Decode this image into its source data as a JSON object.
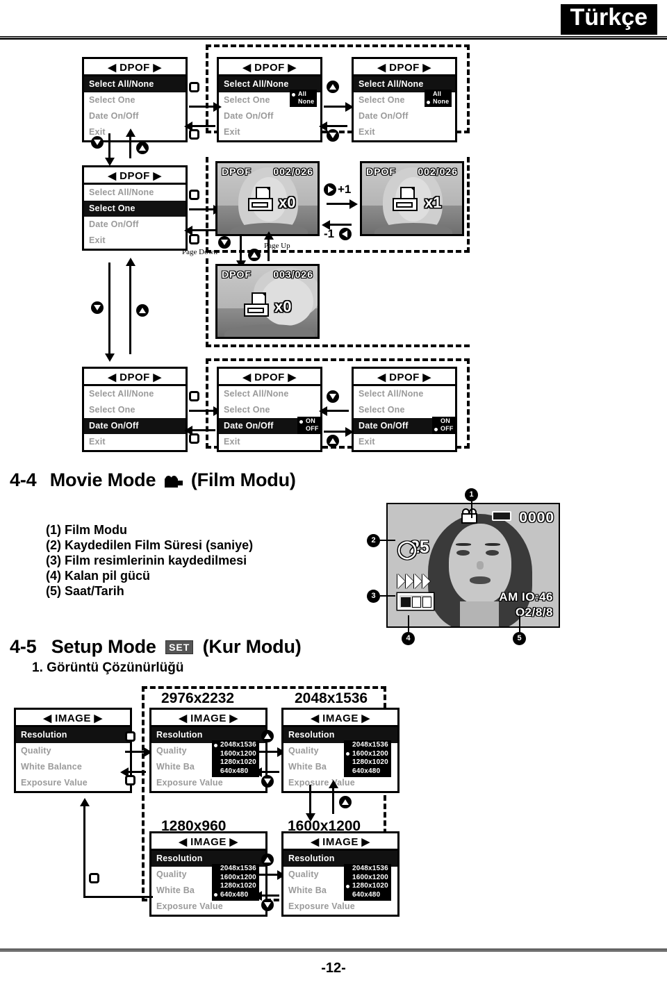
{
  "header": {
    "language": "Türkçe"
  },
  "footer": {
    "page_number": "-12-"
  },
  "dpof": {
    "menu_title": "◀ DPOF ▶",
    "items": {
      "select_all_none": "Select All/None",
      "select_one": "Select One",
      "date_on_off": "Date On/Off",
      "exit": "Exit"
    },
    "all_none_options": {
      "all": "All",
      "none": "None"
    },
    "date_options": {
      "on": "ON",
      "off": "OFF"
    },
    "previews": [
      {
        "label": "DPOF",
        "counter": "002/026",
        "multiplier": "x0"
      },
      {
        "label": "DPOF",
        "counter": "002/026",
        "multiplier": "x1"
      },
      {
        "label": "DPOF",
        "counter": "003/026",
        "multiplier": "x0"
      }
    ],
    "transitions": {
      "plus_one": "+1",
      "minus_one": "-1"
    },
    "paging": {
      "page_up": "Page Up",
      "page_down": "Page Down"
    }
  },
  "movie_section": {
    "number": "4-4",
    "title": "Movie Mode",
    "title_translation": "(Film Modu)",
    "icon": "movie-camera-icon",
    "legend": [
      "(1) Film Modu",
      "(2) Kaydedilen Film Süresi (saniye)",
      "(3) Film resimlerinin kaydedilmesi",
      "(4) Kalan pil gücü",
      "(5) Saat/Tarih"
    ],
    "lcd": {
      "frame_counter": "0000",
      "seconds": "25",
      "time": "AM IO:46",
      "date": "O2/8/8",
      "callouts": [
        "1",
        "2",
        "3",
        "4",
        "5"
      ]
    }
  },
  "setup_section": {
    "number": "4-5",
    "title": "Setup Mode",
    "icon_label": "SET",
    "title_translation": "(Kur Modu)",
    "subheading": "1. Görüntü Çözünürlüğü",
    "menu_title": "◀ IMAGE ▶",
    "items": {
      "resolution": "Resolution",
      "quality": "Quality",
      "white_balance": "White Balance",
      "white_balance_short": "White Ba",
      "exposure_value": "Exposure Value"
    },
    "resolution_options": [
      "2048x1536",
      "1600x1200",
      "1280x1020",
      "640x480"
    ],
    "captions": {
      "panel_2": "2976x2232",
      "panel_3": "2048x1536",
      "panel_4": "1280x960",
      "panel_5": "1600x1200"
    }
  }
}
